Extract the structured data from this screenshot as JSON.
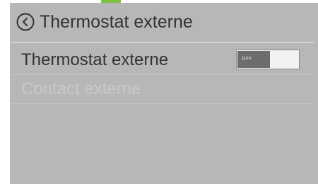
{
  "colors": {
    "accent": "#7dc243",
    "screen_background": "#b7b7b7",
    "text_primary": "#333333",
    "text_disabled": "#c9c9c9",
    "toggle_off_fill": "#6c6c6c"
  },
  "header": {
    "back_icon": "chevron-left-circle-icon",
    "title": "Thermostat externe"
  },
  "settings": {
    "items": [
      {
        "label": "Thermostat externe",
        "control": "toggle",
        "toggle_text": "OFF",
        "enabled": true
      },
      {
        "label": "Contact externe",
        "enabled": false
      }
    ]
  }
}
